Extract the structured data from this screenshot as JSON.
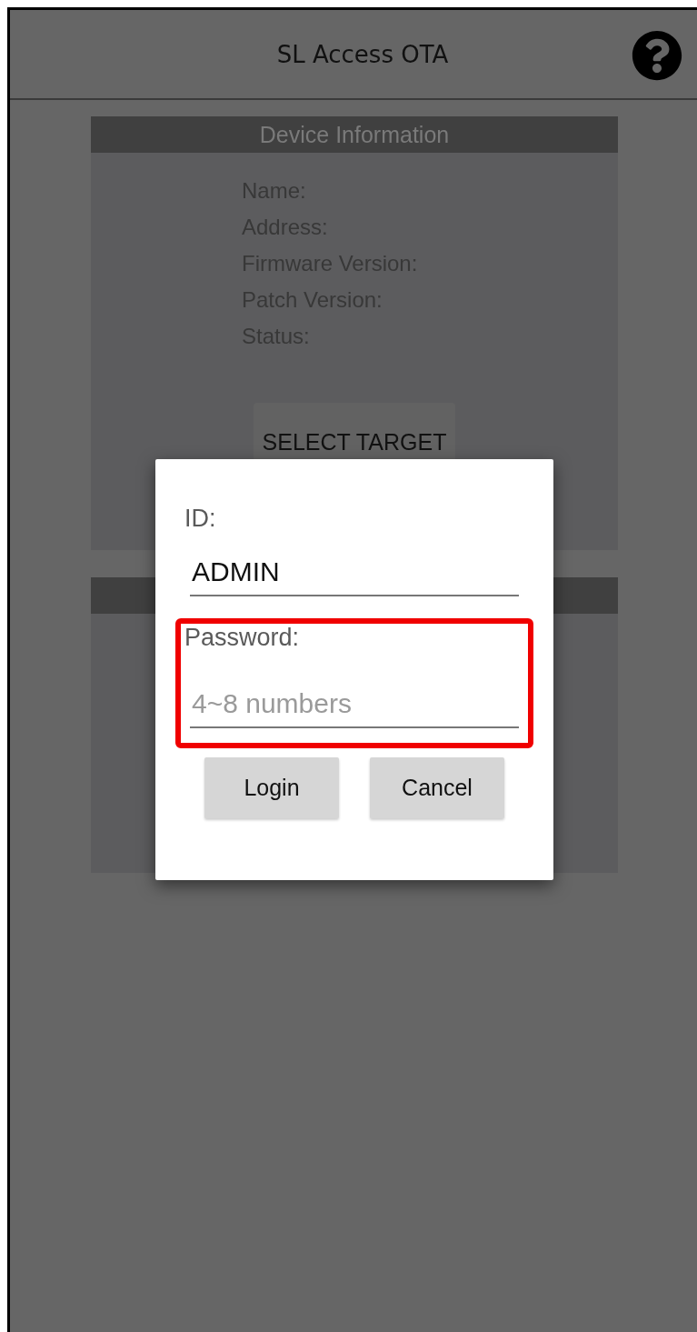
{
  "app_bar": {
    "title": "SL Access OTA"
  },
  "device_info": {
    "title": "Device Information",
    "fields": [
      "Name:",
      "Address:",
      "Firmware Version:",
      "Patch Version:",
      "Status:"
    ],
    "button": "SELECT TARGET"
  },
  "login_dialog": {
    "fields": [
      {
        "label": "ID:",
        "value": "ADMIN",
        "highlighted": false
      },
      {
        "label": "Password:",
        "placeholder": "4~8 numbers",
        "highlighted": true
      }
    ],
    "buttons": [
      "Login",
      "Cancel"
    ]
  }
}
